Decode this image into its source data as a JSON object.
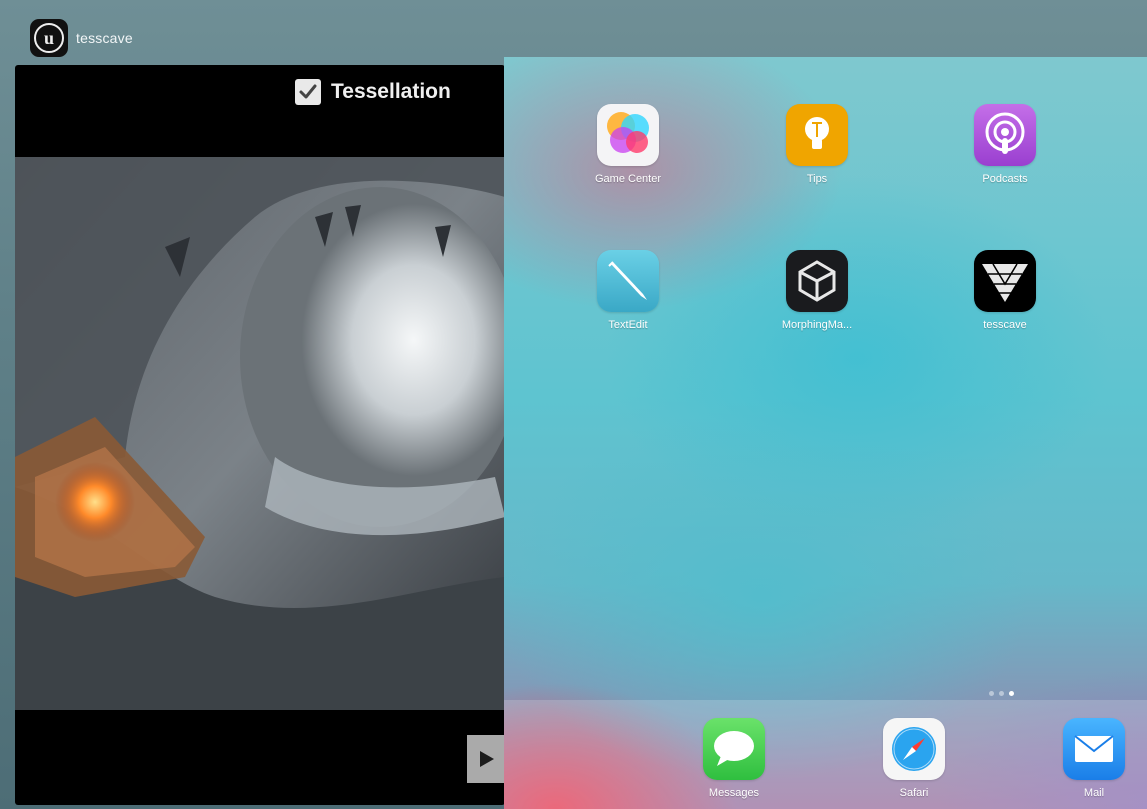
{
  "switcher": {
    "app_name": "tesscave",
    "app_icon": "unreal-engine-logo"
  },
  "game_view": {
    "checkbox_label": "Tessellation",
    "checkbox_checked": true,
    "play_icon": "play-icon"
  },
  "home_screen": {
    "apps": [
      {
        "label": "Game Center",
        "icon": "game-center-icon"
      },
      {
        "label": "Tips",
        "icon": "tips-icon"
      },
      {
        "label": "Podcasts",
        "icon": "podcasts-icon"
      },
      {
        "label": "TextEdit",
        "icon": "textedit-icon"
      },
      {
        "label": "MorphingMa...",
        "icon": "unity-icon"
      },
      {
        "label": "tesscave",
        "icon": "tesscave-icon"
      }
    ],
    "page_count": 3,
    "current_page": 3,
    "dock": [
      {
        "label": "Messages",
        "icon": "messages-icon"
      },
      {
        "label": "Safari",
        "icon": "safari-icon"
      },
      {
        "label": "Mail",
        "icon": "mail-icon"
      }
    ]
  },
  "colors": {
    "tips": "#f0a500",
    "podcasts": "#b35ad9",
    "textedit": "#4cc0dc",
    "messages": "#35c94b",
    "mail": "#1f8ff0"
  }
}
